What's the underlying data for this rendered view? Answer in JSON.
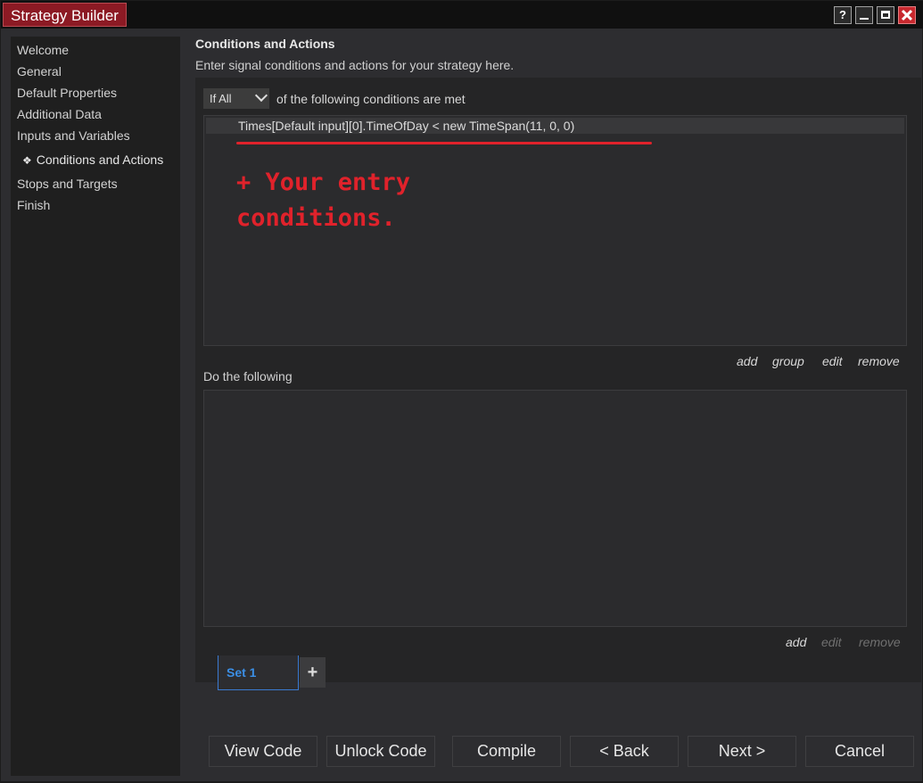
{
  "window": {
    "title": "Strategy Builder",
    "help_glyph": "?"
  },
  "sidebar": {
    "items": [
      {
        "label": "Welcome"
      },
      {
        "label": "General"
      },
      {
        "label": "Default Properties"
      },
      {
        "label": "Additional Data"
      },
      {
        "label": "Inputs and Variables"
      },
      {
        "label": "Conditions and Actions",
        "active": true,
        "bullet": "❖"
      },
      {
        "label": "Stops and Targets"
      },
      {
        "label": "Finish"
      }
    ]
  },
  "main": {
    "title": "Conditions and Actions",
    "description": "Enter signal conditions and actions for your strategy here.",
    "condition_mode": {
      "selected": "If All",
      "suffix": "of the following conditions are met"
    },
    "conditions": [
      "Times[Default input][0].TimeOfDay < new TimeSpan(11, 0, 0)"
    ],
    "annotation": "+ Your entry\nconditions.",
    "condition_links": {
      "add": "add",
      "group": "group",
      "edit": "edit",
      "remove": "remove"
    },
    "actions_label": "Do the following",
    "action_links": {
      "add": "add",
      "edit": "edit",
      "remove": "remove"
    },
    "sets": [
      {
        "label": "Set 1",
        "active": true
      }
    ],
    "add_set_label": "+"
  },
  "footer": {
    "view_code": "View Code",
    "unlock_code": "Unlock Code",
    "compile": "Compile",
    "back": "< Back",
    "next": "Next >",
    "cancel": "Cancel"
  },
  "colors": {
    "title_accent": "#8c1a24",
    "annotation": "#e0222b",
    "active_tab": "#3b8fe6"
  }
}
